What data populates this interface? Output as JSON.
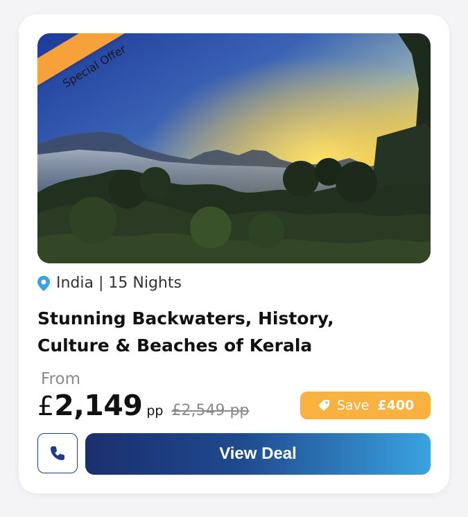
{
  "card": {
    "badge": "Special Offer",
    "location": "India | 15 Nights",
    "title_line1": "Stunning Backwaters, History,",
    "title_line2": "Culture & Beaches of Kerala",
    "from_label": "From",
    "currency": "£",
    "price": "2,149",
    "price_unit": "pp",
    "old_price": "£2,549 pp",
    "save_label": "Save",
    "save_amount": "£400",
    "cta_label": "View Deal"
  },
  "icons": {
    "location": "map-pin-icon",
    "tag": "tag-icon",
    "phone": "phone-icon"
  },
  "colors": {
    "ribbon": "#f6a13a",
    "save_badge": "#fbb140",
    "pin": "#3ba4e0",
    "cta_start": "#1b2f6e",
    "cta_end": "#3aa3df",
    "call_border": "#1e3a8a"
  }
}
